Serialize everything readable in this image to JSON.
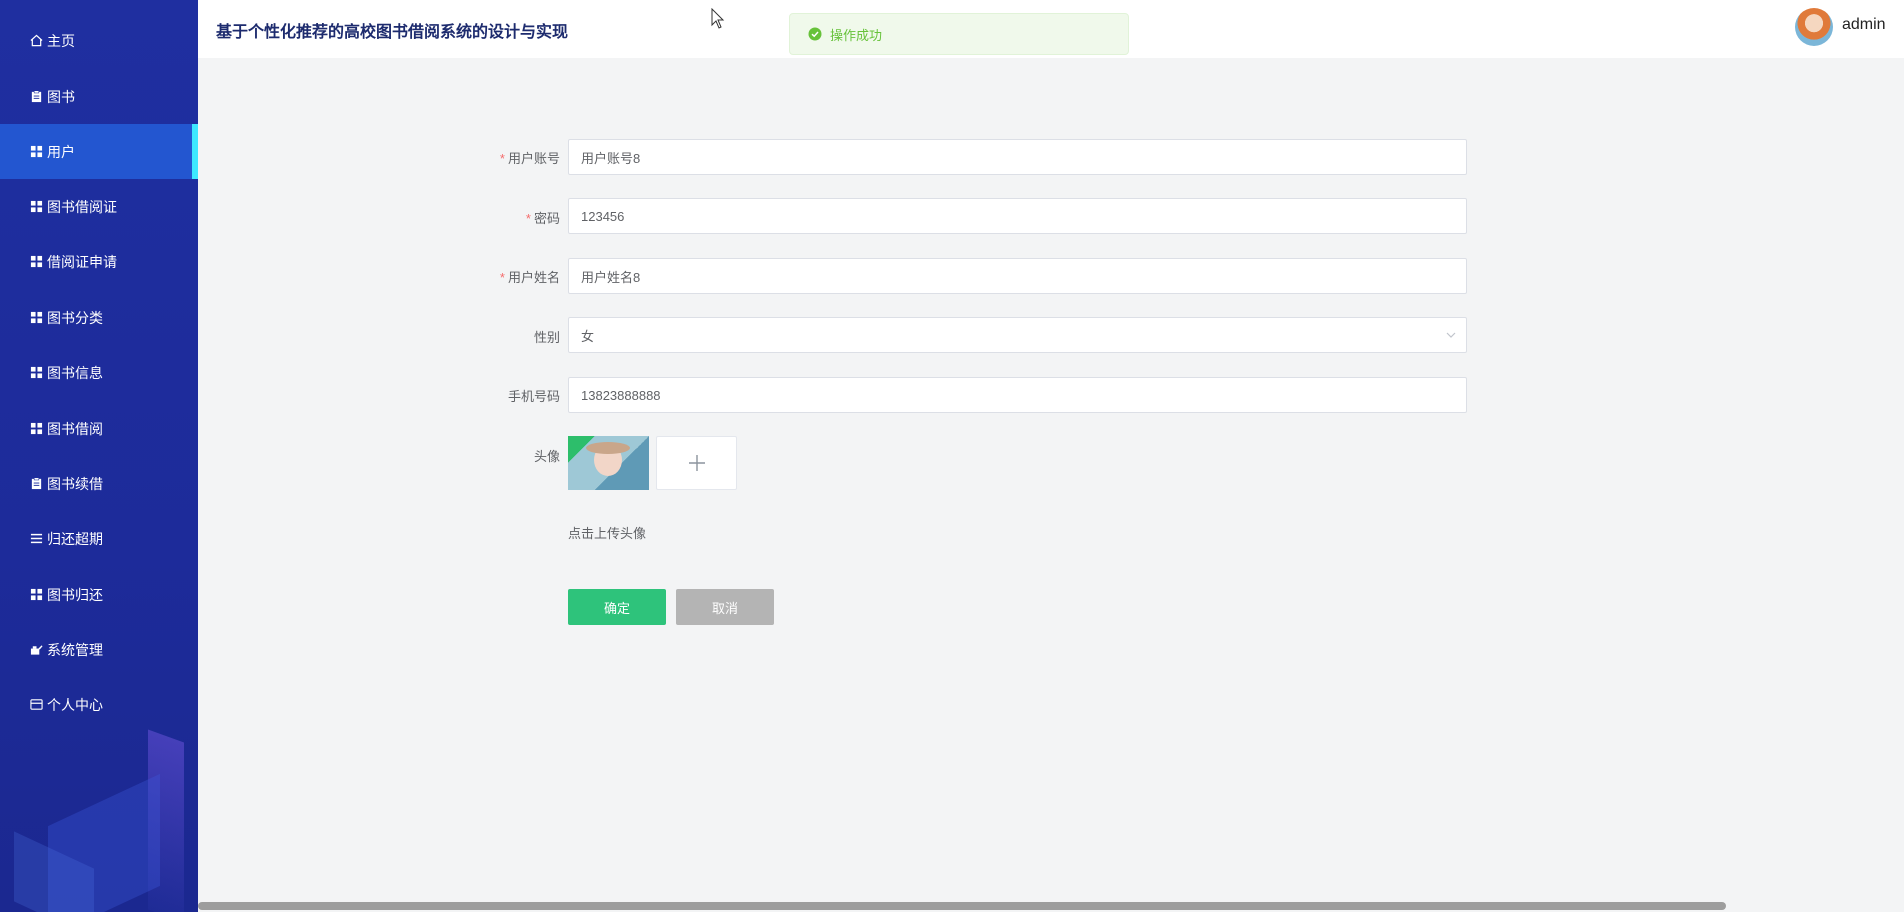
{
  "header": {
    "title": "基于个性化推荐的高校图书借阅系统的设计与实现",
    "username": "admin"
  },
  "toast": {
    "message": "操作成功"
  },
  "sidebar": {
    "items": [
      {
        "label": "主页",
        "icon": "home-icon"
      },
      {
        "label": "图书",
        "icon": "clipboard-icon"
      },
      {
        "label": "用户",
        "icon": "grid-icon",
        "active": true
      },
      {
        "label": "图书借阅证",
        "icon": "grid-icon"
      },
      {
        "label": "借阅证申请",
        "icon": "grid-icon"
      },
      {
        "label": "图书分类",
        "icon": "grid-icon"
      },
      {
        "label": "图书信息",
        "icon": "grid-icon"
      },
      {
        "label": "图书借阅",
        "icon": "grid-icon"
      },
      {
        "label": "图书续借",
        "icon": "clipboard-icon"
      },
      {
        "label": "归还超期",
        "icon": "list-icon"
      },
      {
        "label": "图书归还",
        "icon": "grid-icon"
      },
      {
        "label": "系统管理",
        "icon": "settings-icon"
      },
      {
        "label": "个人中心",
        "icon": "card-icon"
      }
    ]
  },
  "form": {
    "required_mark": "*",
    "account": {
      "label": "用户账号",
      "value": "用户账号8"
    },
    "password": {
      "label": "密码",
      "value": "123456"
    },
    "name": {
      "label": "用户姓名",
      "value": "用户姓名8"
    },
    "gender": {
      "label": "性别",
      "value": "女"
    },
    "phone": {
      "label": "手机号码",
      "value": "13823888888"
    },
    "avatar": {
      "label": "头像",
      "hint": "点击上传头像"
    },
    "confirm_label": "确定",
    "cancel_label": "取消"
  },
  "colors": {
    "sidebar_bg": "#1f2fa0",
    "active_item": "#2356d0",
    "active_bar": "#3de8ff",
    "confirm": "#2ec37b",
    "cancel": "#b4b4b4",
    "success": "#67c23a"
  }
}
